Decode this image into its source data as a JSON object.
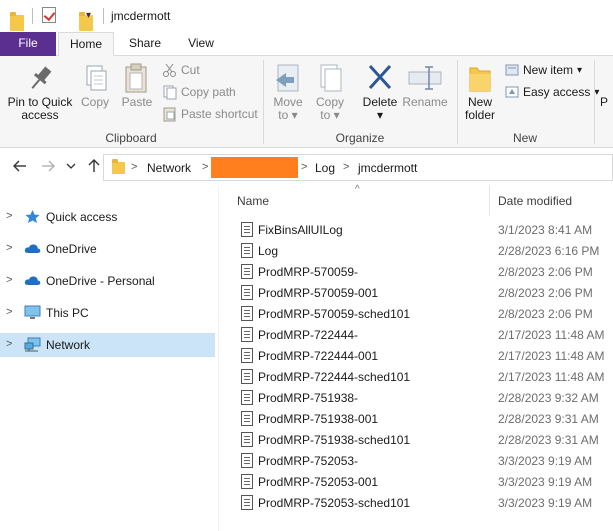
{
  "window": {
    "title": "jmcdermott",
    "quick_access_dropdown": "▾"
  },
  "tabs": [
    {
      "label": "File",
      "active": false
    },
    {
      "label": "Home",
      "active": true
    },
    {
      "label": "Share",
      "active": false
    },
    {
      "label": "View",
      "active": false
    }
  ],
  "ribbon": {
    "clipboard": {
      "group_label": "Clipboard",
      "pin_line1": "Pin to Quick",
      "pin_line2": "access",
      "copy": "Copy",
      "paste": "Paste",
      "cut": "Cut",
      "copy_path": "Copy path",
      "paste_shortcut": "Paste shortcut"
    },
    "organize": {
      "group_label": "Organize",
      "move_to_line1": "Move",
      "move_to_line2": "to",
      "copy_to_line1": "Copy",
      "copy_to_line2": "to",
      "delete": "Delete",
      "rename": "Rename",
      "dropdown_caret": "▾"
    },
    "new": {
      "group_label": "New",
      "new_folder_line1": "New",
      "new_folder_line2": "folder",
      "new_item": "New item",
      "easy_access": "Easy access"
    },
    "overflow_label": "P"
  },
  "address_bar": {
    "breadcrumbs": [
      "Network",
      "Log",
      "jmcdermott"
    ],
    "redacted_color": "#ff7f1f"
  },
  "nav_pane": {
    "items": [
      {
        "label": "Quick access",
        "icon": "star-icon",
        "selected": false
      },
      {
        "label": "OneDrive",
        "icon": "cloud-icon",
        "selected": false
      },
      {
        "label": "OneDrive - Personal",
        "icon": "cloud-icon",
        "selected": false
      },
      {
        "label": "This PC",
        "icon": "monitor-icon",
        "selected": false
      },
      {
        "label": "Network",
        "icon": "network-icon",
        "selected": true
      }
    ]
  },
  "file_list": {
    "columns": {
      "name": "Name",
      "date_modified": "Date modified"
    },
    "files": [
      {
        "name": "FixBinsAllUILog",
        "date": "3/1/2023 8:41 AM"
      },
      {
        "name": "Log",
        "date": "2/28/2023 6:16 PM"
      },
      {
        "name": "ProdMRP-570059-",
        "date": "2/8/2023 2:06 PM"
      },
      {
        "name": "ProdMRP-570059-001",
        "date": "2/8/2023 2:06 PM"
      },
      {
        "name": "ProdMRP-570059-sched101",
        "date": "2/8/2023 2:06 PM"
      },
      {
        "name": "ProdMRP-722444-",
        "date": "2/17/2023 11:48 AM"
      },
      {
        "name": "ProdMRP-722444-001",
        "date": "2/17/2023 11:48 AM"
      },
      {
        "name": "ProdMRP-722444-sched101",
        "date": "2/17/2023 11:48 AM"
      },
      {
        "name": "ProdMRP-751938-",
        "date": "2/28/2023 9:32 AM"
      },
      {
        "name": "ProdMRP-751938-001",
        "date": "2/28/2023 9:31 AM"
      },
      {
        "name": "ProdMRP-751938-sched101",
        "date": "2/28/2023 9:31 AM"
      },
      {
        "name": "ProdMRP-752053-",
        "date": "3/3/2023 9:19 AM"
      },
      {
        "name": "ProdMRP-752053-001",
        "date": "3/3/2023 9:19 AM"
      },
      {
        "name": "ProdMRP-752053-sched101",
        "date": "3/3/2023 9:19 AM"
      }
    ]
  },
  "colors": {
    "file_tab": "#5b2f8f",
    "selection": "#cce4f7",
    "folder": "#f6c84a",
    "delete_x": "#2b5797"
  }
}
